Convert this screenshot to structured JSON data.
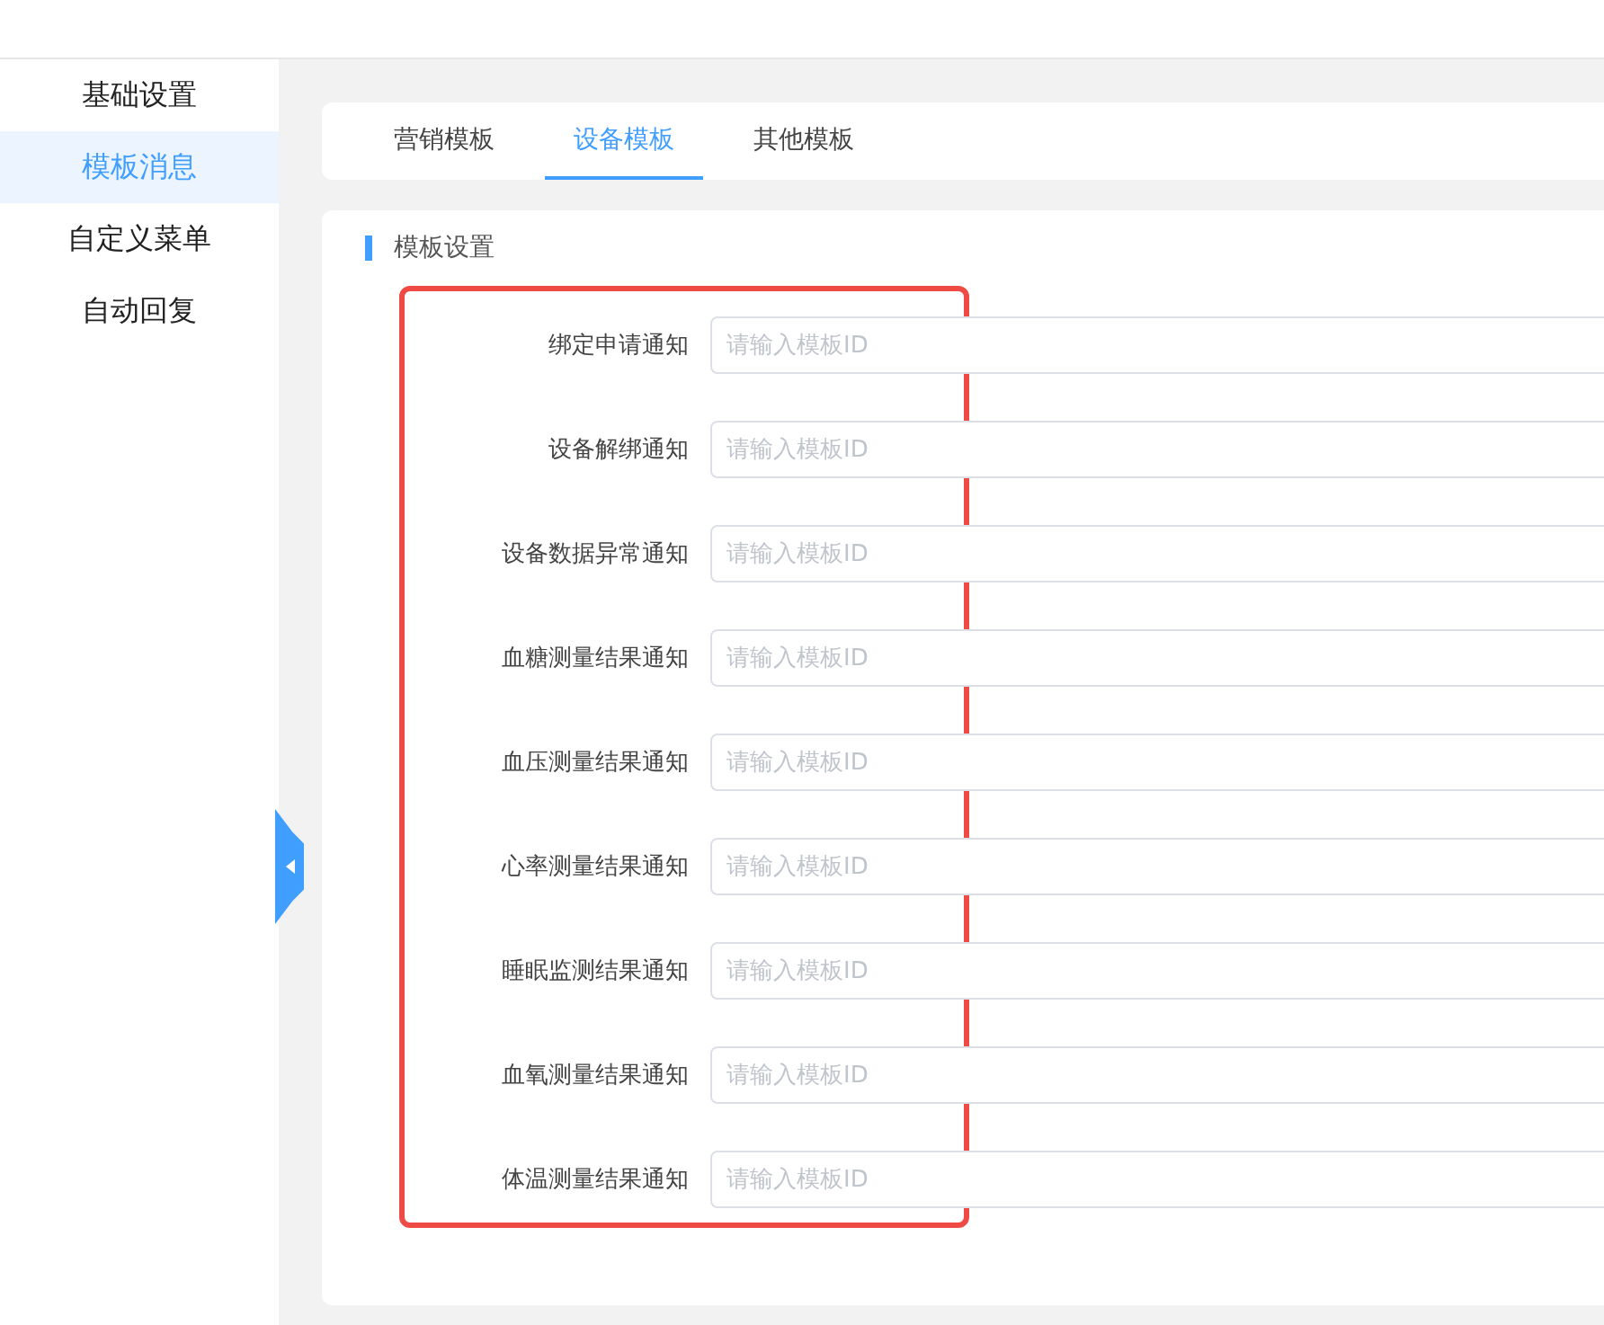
{
  "sidebar": {
    "items": [
      {
        "label": "基础设置",
        "selected": false
      },
      {
        "label": "模板消息",
        "selected": true
      },
      {
        "label": "自定义菜单",
        "selected": false
      },
      {
        "label": "自动回复",
        "selected": false
      }
    ]
  },
  "tabs": [
    {
      "label": "营销模板",
      "selected": false
    },
    {
      "label": "设备模板",
      "selected": true
    },
    {
      "label": "其他模板",
      "selected": false
    }
  ],
  "section": {
    "title": "模板设置"
  },
  "fields": [
    {
      "label": "绑定申请通知",
      "placeholder": "请输入模板ID"
    },
    {
      "label": "设备解绑通知",
      "placeholder": "请输入模板ID"
    },
    {
      "label": "设备数据异常通知",
      "placeholder": "请输入模板ID"
    },
    {
      "label": "血糖测量结果通知",
      "placeholder": "请输入模板ID"
    },
    {
      "label": "血压测量结果通知",
      "placeholder": "请输入模板ID"
    },
    {
      "label": "心率测量结果通知",
      "placeholder": "请输入模板ID"
    },
    {
      "label": "睡眠监测结果通知",
      "placeholder": "请输入模板ID"
    },
    {
      "label": "血氧测量结果通知",
      "placeholder": "请输入模板ID"
    },
    {
      "label": "体温测量结果通知",
      "placeholder": "请输入模板ID"
    }
  ]
}
